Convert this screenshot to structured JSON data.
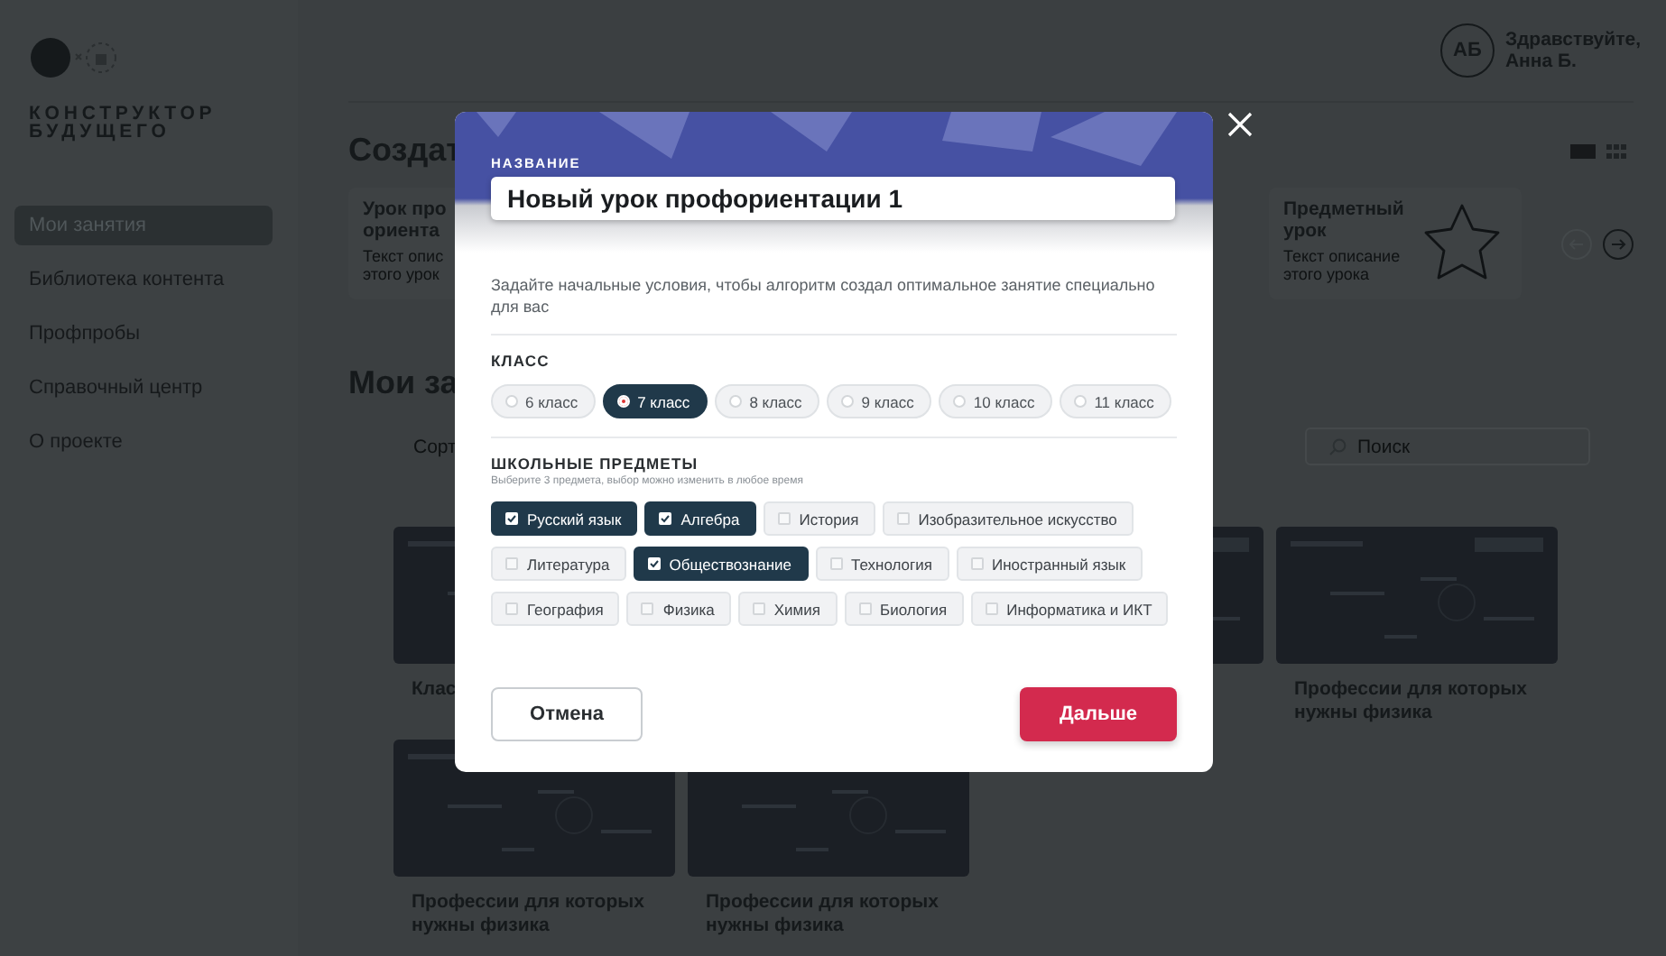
{
  "sidebar": {
    "logo_lines": [
      "КОНСТРУКТОР",
      "БУДУЩЕГО"
    ],
    "items": [
      {
        "label": "Мои занятия",
        "selected": true
      },
      {
        "label": "Библиотека контента",
        "selected": false
      },
      {
        "label": "Профпробы",
        "selected": false
      },
      {
        "label": "Справочный центр",
        "selected": false
      },
      {
        "label": "О проекте",
        "selected": false
      }
    ]
  },
  "header": {
    "avatar_initials": "АБ",
    "greeting": "Здравствуйте,",
    "user_name": "Анна Б."
  },
  "create_section": {
    "title": "Создат",
    "cards": [
      {
        "kind": "text",
        "title": [
          "Урок про",
          "ориента"
        ],
        "description": [
          "Текст опис",
          "этого урок"
        ]
      },
      {
        "kind": "star",
        "title": [
          "Предметный",
          "урок"
        ],
        "description": [
          "Текст описание",
          "этого урока"
        ]
      }
    ]
  },
  "lessons_section": {
    "title": "Мои за",
    "sort_label": "Сорт",
    "search": {
      "placeholder": "Поиск"
    },
    "cards": [
      {
        "kind": "lesson",
        "title": "Клас"
      },
      {
        "kind": "covered"
      },
      {
        "kind": "lesson"
      },
      {
        "kind": "lesson",
        "title": "Профессии для которых нужны физика"
      },
      {
        "kind": "lesson",
        "title": "Профессии для которых нужны физика"
      },
      {
        "kind": "lesson",
        "title": "Профессии для которых нужны физика"
      }
    ]
  },
  "modal": {
    "name_label": "НАЗВАНИЕ",
    "name_value": "Новый урок профориентации 1",
    "intro": "Задайте начальные условия, чтобы алгоритм создал оптимальное занятие специально для вас",
    "grade": {
      "label": "КЛАСС",
      "options": [
        {
          "label": "6 класс",
          "selected": false
        },
        {
          "label": "7 класс",
          "selected": true
        },
        {
          "label": "8 класс",
          "selected": false
        },
        {
          "label": "9 класс",
          "selected": false
        },
        {
          "label": "10 класс",
          "selected": false
        },
        {
          "label": "11 класс",
          "selected": false
        }
      ]
    },
    "subjects": {
      "label": "ШКОЛЬНЫЕ ПРЕДМЕТЫ",
      "hint": "Выберите 3 предмета, выбор можно изменить в любое время",
      "options": [
        {
          "label": "Русский язык",
          "checked": true
        },
        {
          "label": "Алгебра",
          "checked": true
        },
        {
          "label": "История",
          "checked": false
        },
        {
          "label": "Изобразительное искусство",
          "checked": false
        },
        {
          "label": "Литература",
          "checked": false
        },
        {
          "label": "Обществознание",
          "checked": true
        },
        {
          "label": "Технология",
          "checked": false
        },
        {
          "label": "Иностранный язык",
          "checked": false
        },
        {
          "label": "География",
          "checked": false
        },
        {
          "label": "Физика",
          "checked": false
        },
        {
          "label": "Химия",
          "checked": false
        },
        {
          "label": "Биология",
          "checked": false
        },
        {
          "label": "Информатика и ИКТ",
          "checked": false
        }
      ]
    },
    "cancel_button": "Отмена",
    "next_button": "Дальше"
  }
}
